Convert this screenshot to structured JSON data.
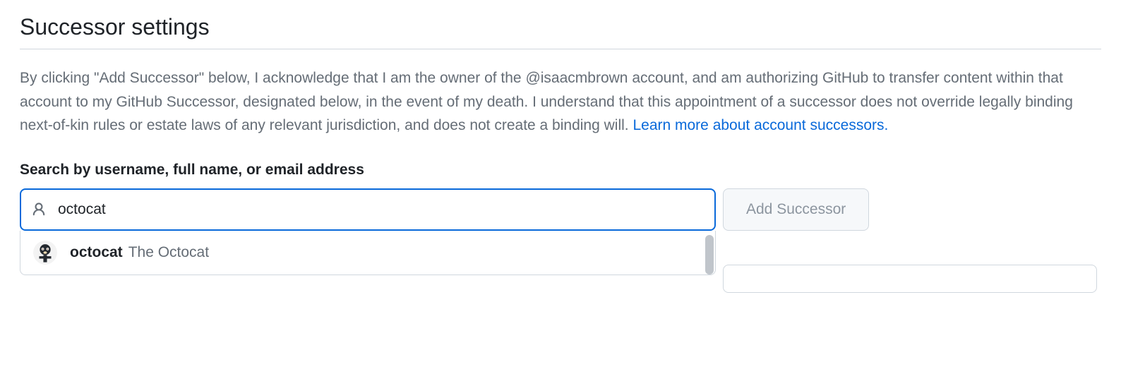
{
  "header": {
    "title": "Successor settings"
  },
  "description": {
    "text": "By clicking \"Add Successor\" below, I acknowledge that I am the owner of the @isaacmbrown account, and am authorizing GitHub to transfer content within that account to my GitHub Successor, designated below, in the event of my death. I understand that this appointment of a successor does not override legally binding next-of-kin rules or estate laws of any relevant jurisdiction, and does not create a binding will. ",
    "link_text": "Learn more about account successors."
  },
  "search": {
    "label": "Search by username, full name, or email address",
    "value": "octocat",
    "button_label": "Add Successor",
    "results": [
      {
        "username": "octocat",
        "fullname": "The Octocat"
      }
    ]
  }
}
